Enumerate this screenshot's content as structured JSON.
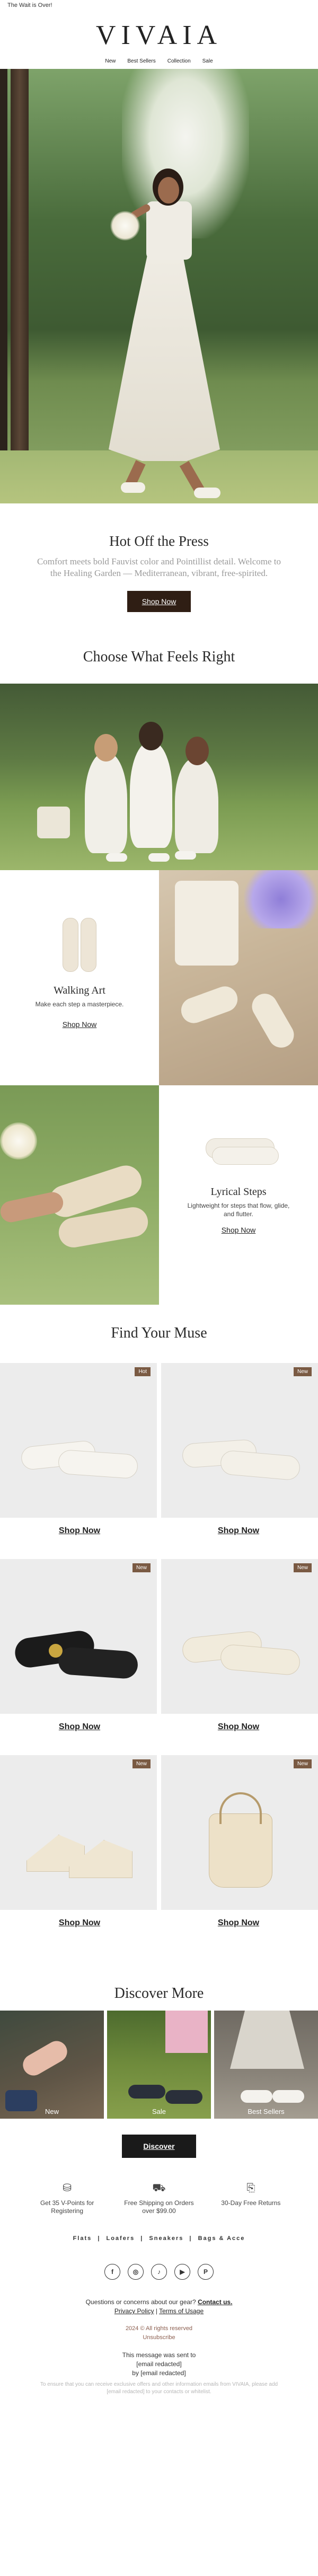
{
  "topbar": {
    "text": "The Wait is Over!"
  },
  "brand": {
    "logo": "VIVAIA"
  },
  "nav": [
    "New",
    "Best Sellers",
    "Collection",
    "Sale"
  ],
  "intro": {
    "title": "Hot Off the Press",
    "body": "Comfort meets bold Fauvist color and Pointillist detail. Welcome to the Healing Garden — Mediterranean, vibrant, free-spirited.",
    "cta": "Shop Now"
  },
  "choose": {
    "title": "Choose What Feels Right"
  },
  "walking": {
    "title": "Walking Art",
    "sub": "Make each step a masterpiece.",
    "cta": "Shop Now"
  },
  "lyrical": {
    "title": "Lyrical Steps",
    "sub": "Lightweight for steps that flow, glide, and flutter.",
    "cta": "Shop Now"
  },
  "muse": {
    "title": "Find Your Muse",
    "products": [
      {
        "badge": "Hot",
        "cta": "Shop Now"
      },
      {
        "badge": "New",
        "cta": "Shop Now"
      },
      {
        "badge": "New",
        "cta": "Shop Now"
      },
      {
        "badge": "New",
        "cta": "Shop Now"
      },
      {
        "badge": "New",
        "cta": "Shop Now"
      },
      {
        "badge": "New",
        "cta": "Shop Now"
      }
    ]
  },
  "discover": {
    "title": "Discover More",
    "tiles": [
      "New",
      "Sale",
      "Best Sellers"
    ],
    "cta": "Discover"
  },
  "perks": [
    {
      "icon": "coins-icon",
      "text": "Get 35 V-Points for Registering"
    },
    {
      "icon": "truck-icon",
      "text": "Free Shipping on Orders over $99.00"
    },
    {
      "icon": "return-box-icon",
      "text": "30-Day Free Returns"
    }
  ],
  "categories": [
    "Flats",
    "Loafers",
    "Sneakers",
    "Bags & Acce"
  ],
  "social": [
    {
      "icon": "facebook-icon",
      "glyph": "f"
    },
    {
      "icon": "instagram-icon",
      "glyph": "◎"
    },
    {
      "icon": "tiktok-icon",
      "glyph": "♪"
    },
    {
      "icon": "youtube-icon",
      "glyph": "▶"
    },
    {
      "icon": "pinterest-icon",
      "glyph": "P"
    }
  ],
  "footer": {
    "questions": "Questions or concerns about our gear?",
    "contact": "Contact us.",
    "privacy": "Privacy Policy",
    "sep": "|",
    "terms": "Terms of Usage",
    "copyright": "2024 © All rights reserved",
    "unsubscribe": "Unsubscribe",
    "sent_line1": "This message was sent to",
    "sent_line2": "[email redacted]",
    "sent_line3": "by [email redacted]",
    "fine": "To ensure that you can receive exclusive offers and other information emails from VIVAIA, please add [email redacted] to your contacts or whitelist."
  },
  "colors": {
    "accent_brown": "#2f1e14",
    "badge": "#7a5a43",
    "black": "#1a1a1a"
  }
}
